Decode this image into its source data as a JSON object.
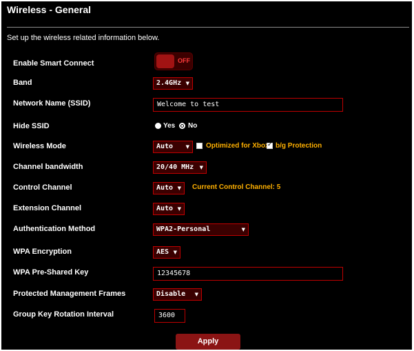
{
  "page": {
    "title": "Wireless - General",
    "description": "Set up the wireless related information below."
  },
  "settings": {
    "smart_connect": {
      "label": "Enable Smart Connect",
      "state": "OFF"
    },
    "band": {
      "label": "Band",
      "value": "2.4GHz"
    },
    "ssid": {
      "label": "Network Name (SSID)",
      "value": "Welcome to test"
    },
    "hide_ssid": {
      "label": "Hide SSID",
      "yes": "Yes",
      "no": "No",
      "selected": "No"
    },
    "wireless_mode": {
      "label": "Wireless Mode",
      "value": "Auto",
      "xbox_label": "Optimized for Xbox",
      "xbox_checked": false,
      "bg_label": "b/g Protection",
      "bg_checked": true
    },
    "channel_bandwidth": {
      "label": "Channel bandwidth",
      "value": "20/40 MHz"
    },
    "control_channel": {
      "label": "Control Channel",
      "value": "Auto",
      "current": "Current Control Channel: 5"
    },
    "extension_channel": {
      "label": "Extension Channel",
      "value": "Auto"
    },
    "auth_method": {
      "label": "Authentication Method",
      "value": "WPA2-Personal"
    },
    "wpa_encryption": {
      "label": "WPA Encryption",
      "value": "AES"
    },
    "psk": {
      "label": "WPA Pre-Shared Key",
      "value": "12345678"
    },
    "pmf": {
      "label": "Protected Management Frames",
      "value": "Disable"
    },
    "gkri": {
      "label": "Group Key Rotation Interval",
      "value": "3600"
    }
  },
  "actions": {
    "apply": "Apply"
  },
  "icons": {
    "dropdown": "chevron-down-icon"
  },
  "colors": {
    "accent": "#c00000",
    "button": "#8b1414",
    "highlight": "#ffb000",
    "background": "#000000"
  }
}
